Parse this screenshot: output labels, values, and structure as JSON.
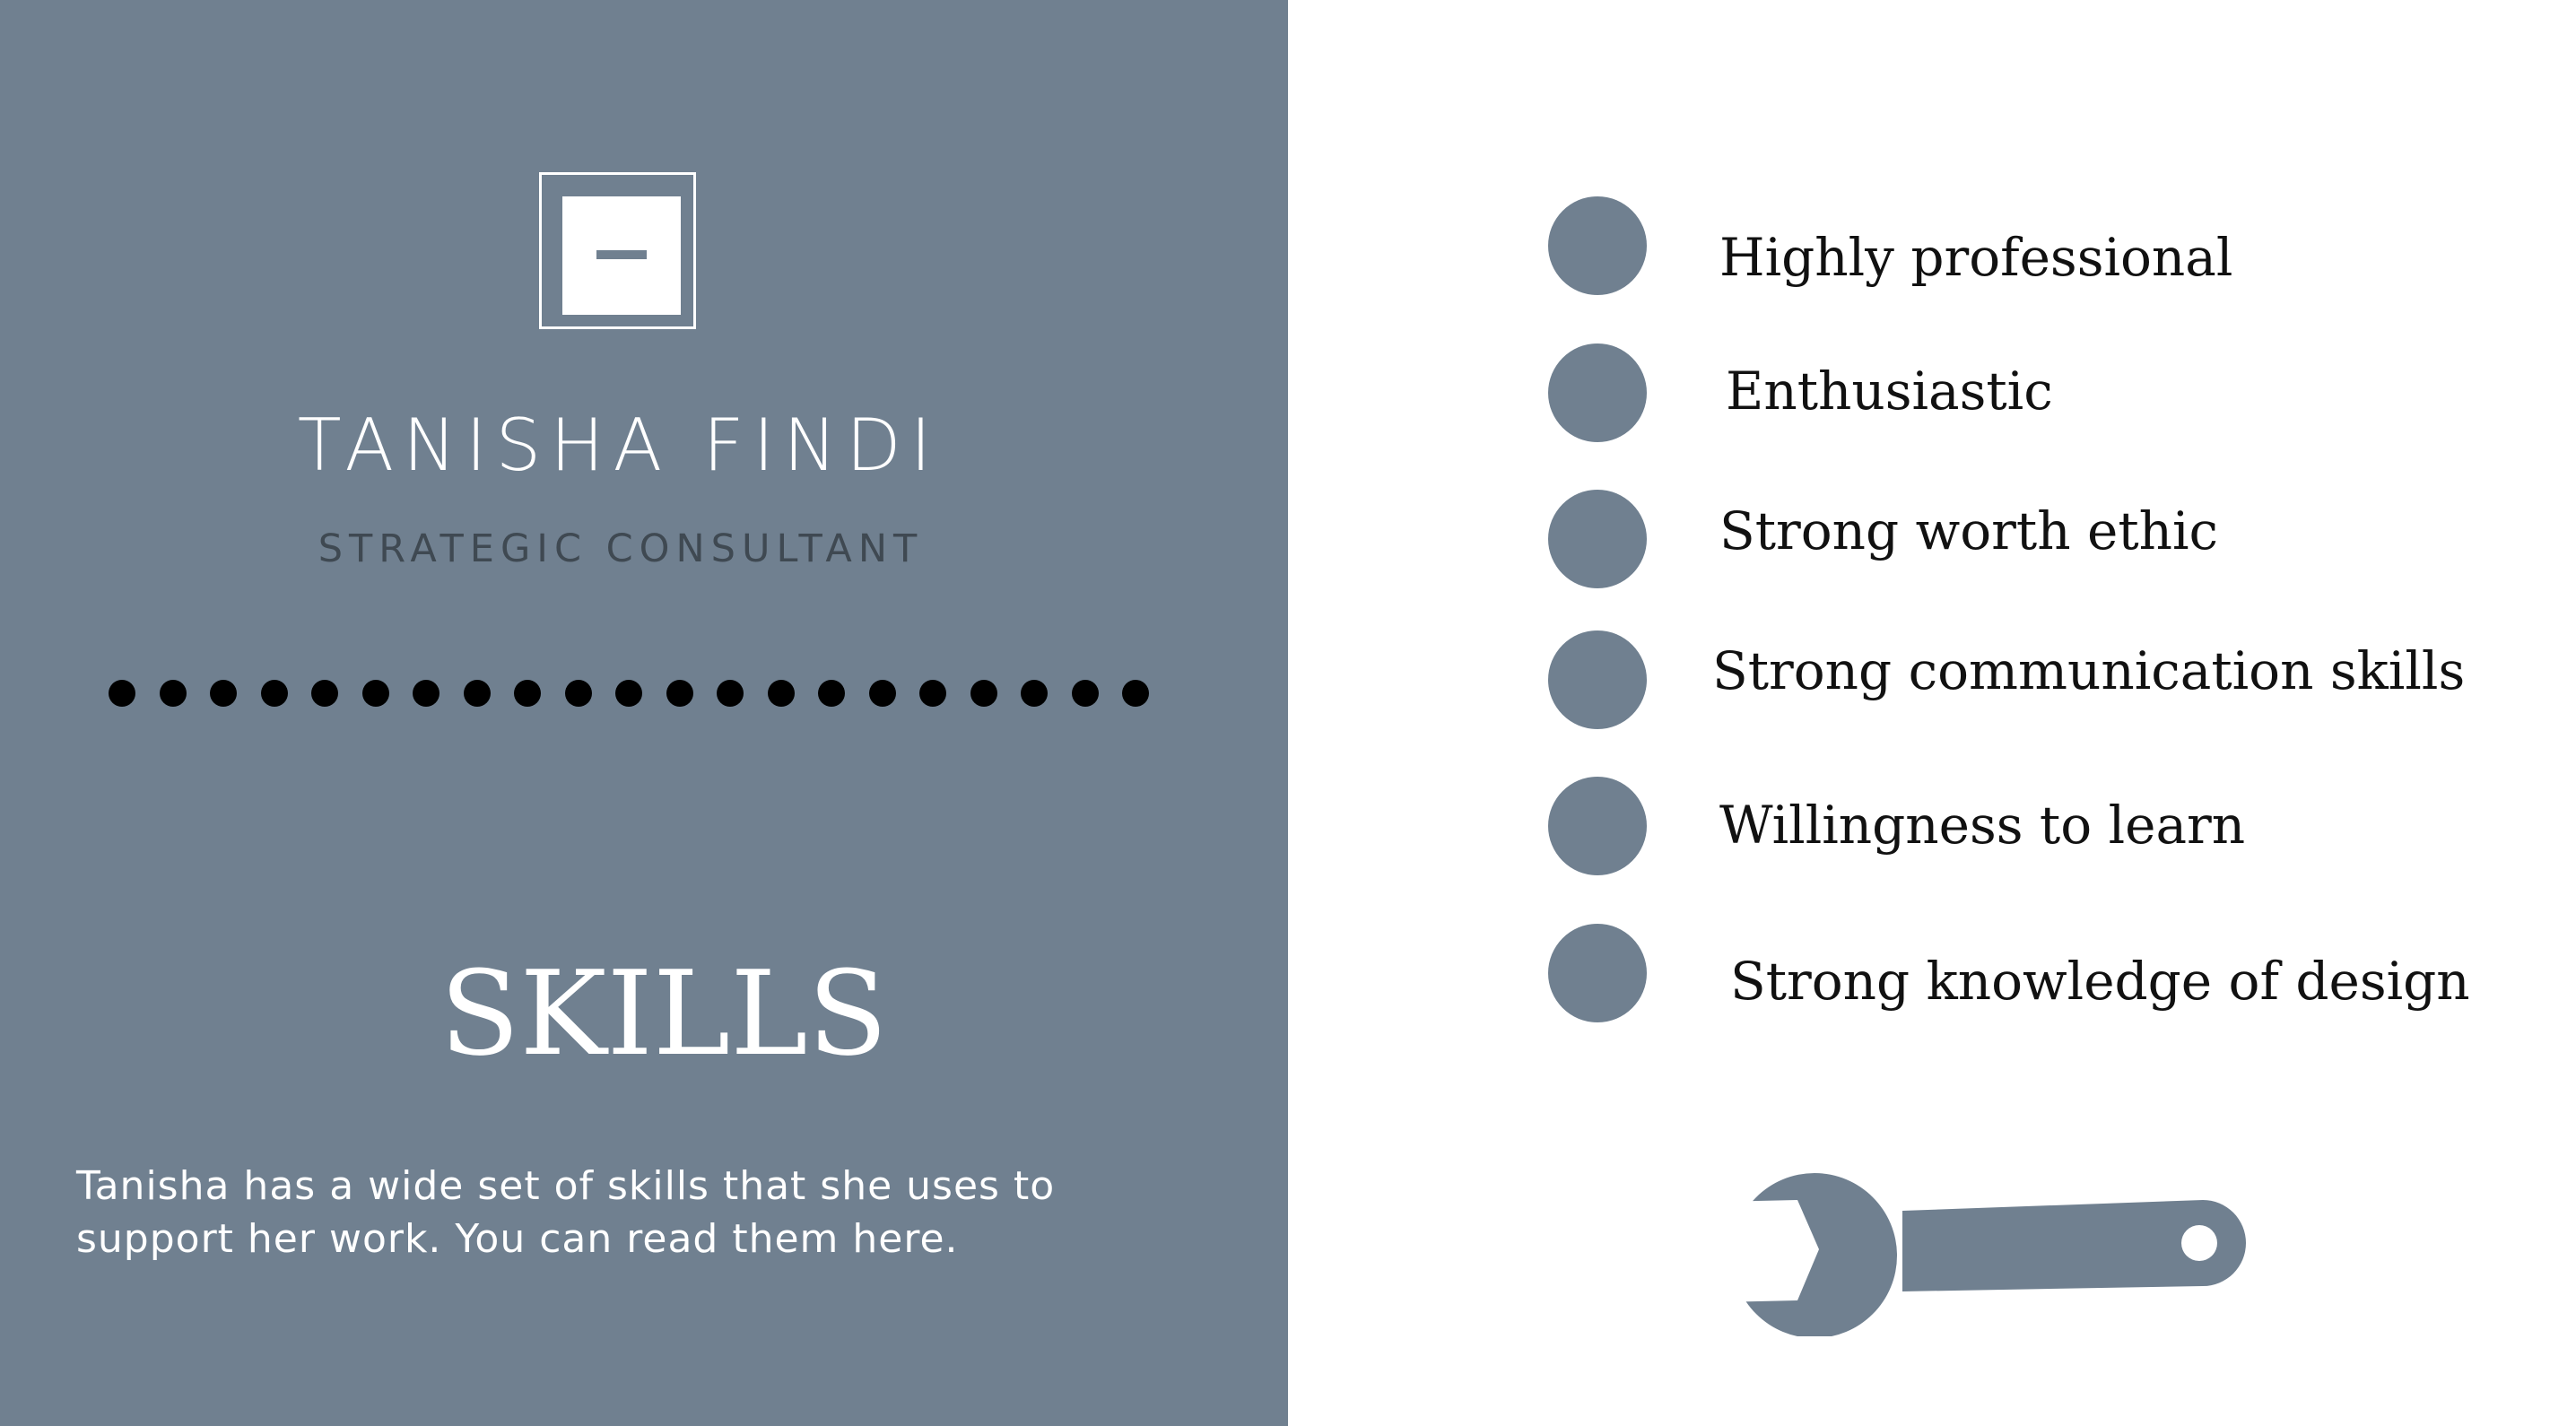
{
  "colors": {
    "accent": "#708090",
    "panel_text": "#ffffff",
    "role_text": "#3f4952",
    "body_text": "#111111",
    "dots": "#000000"
  },
  "profile": {
    "logo_icon": "minus-square-icon",
    "name": "TANISHA FINDI",
    "role": "STRATEGIC CONSULTANT",
    "divider_dot_count": 21
  },
  "section": {
    "title": "SKILLS",
    "description": "Tanisha has a wide set of skills that she uses to support her work. You can read them here."
  },
  "skills": [
    {
      "label": "Highly professional"
    },
    {
      "label": "Enthusiastic"
    },
    {
      "label": "Strong worth ethic"
    },
    {
      "label": "Strong communication skills"
    },
    {
      "label": "Willingness to learn"
    },
    {
      "label": "Strong knowledge of design"
    }
  ],
  "decoration": {
    "icon": "wrench-icon"
  }
}
